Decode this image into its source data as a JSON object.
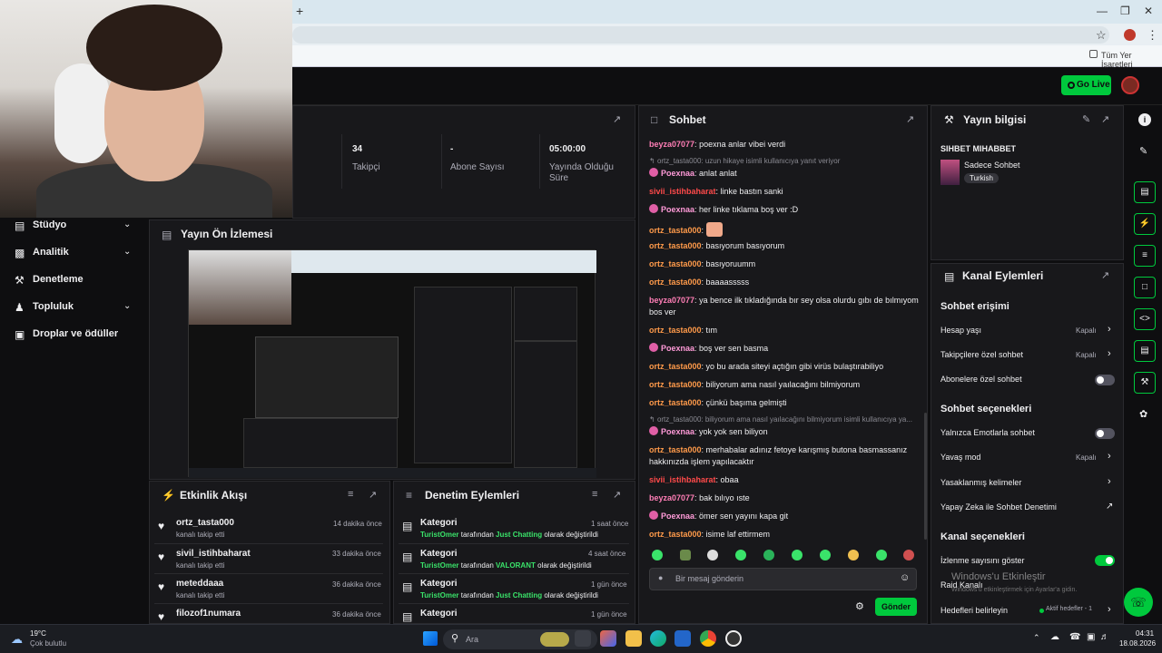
{
  "browser": {
    "new_tab": "+",
    "bookmarks_label": "Tüm Yer İşaretleri"
  },
  "topnav": {
    "go_live": "Go Live"
  },
  "stats": [
    {
      "value": "34",
      "label": "Takipçi"
    },
    {
      "value": "-",
      "label": "Abone Sayısı"
    },
    {
      "value": "05:00:00",
      "label": "Yayında Olduğu Süre"
    }
  ],
  "sidebar": {
    "items": [
      {
        "label": "Stüdyo",
        "icon": "film-icon",
        "chevron": true
      },
      {
        "label": "Analitik",
        "icon": "chart-icon",
        "chevron": true
      },
      {
        "label": "Denetleme",
        "icon": "wrench-icon",
        "chevron": false
      },
      {
        "label": "Topluluk",
        "icon": "community-icon",
        "chevron": true
      },
      {
        "label": "Droplar ve ödüller",
        "icon": "gift-icon",
        "chevron": false
      }
    ]
  },
  "preview": {
    "title": "Yayın Ön İzlemesi"
  },
  "activity": {
    "title": "Etkinlik Akışı",
    "items": [
      {
        "name": "ortz_tasta000",
        "sub": "kanalı takip etti",
        "time": "14 dakika önce"
      },
      {
        "name": "sivil_istihbaharat",
        "sub": "kanalı takip etti",
        "time": "33 dakika önce"
      },
      {
        "name": "meteddaaa",
        "sub": "kanalı takip etti",
        "time": "36 dakika önce"
      },
      {
        "name": "filozof1numara",
        "sub": "",
        "time": "36 dakika önce"
      }
    ]
  },
  "modactions": {
    "title": "Denetim Eylemleri",
    "items": [
      {
        "name": "Kategori",
        "actor": "TuristOmer",
        "mid": " tarafından ",
        "target": "Just Chatting",
        "tail": " olarak değiştirildi",
        "time": "1 saat önce"
      },
      {
        "name": "Kategori",
        "actor": "TuristOmer",
        "mid": " tarafından ",
        "target": "VALORANT",
        "tail": " olarak değiştirildi",
        "time": "4 saat önce"
      },
      {
        "name": "Kategori",
        "actor": "TuristOmer",
        "mid": " tarafından ",
        "target": "Just Chatting",
        "tail": " olarak değiştirildi",
        "time": "1 gün önce"
      },
      {
        "name": "Kategori",
        "actor": "",
        "mid": "",
        "target": "",
        "tail": "",
        "time": "1 gün önce"
      }
    ]
  },
  "chat": {
    "title": "Sohbet",
    "placeholder": "Bir mesaj gönderin",
    "send": "Gönder",
    "messages": [
      {
        "user": "beyza07077",
        "color": "#ff7eb6",
        "text": "poexna anlar vibei verdi"
      },
      {
        "reply": "ortz_tasta000: uzun hikaye isimli kullanıcıya yanıt veriyor"
      },
      {
        "user": "Poexnaa",
        "color": "#ff9ad8",
        "badge": true,
        "text": "anlat anlat"
      },
      {
        "user": "sivii_istihbaharat",
        "color": "#ff4a4a",
        "text": "linke bastın sanki"
      },
      {
        "user": "Poexnaa",
        "color": "#ff9ad8",
        "badge": true,
        "text": "her linke tıklama boş ver :D"
      },
      {
        "user": "ortz_tasta000",
        "color": "#ff9a4a",
        "text": "",
        "emote": true
      },
      {
        "user": "ortz_tasta000",
        "color": "#ff9a4a",
        "text": "basıyorum basıyorum"
      },
      {
        "user": "ortz_tasta000",
        "color": "#ff9a4a",
        "text": "basıyoruumm"
      },
      {
        "user": "ortz_tasta000",
        "color": "#ff9a4a",
        "text": "baaaasssss"
      },
      {
        "user": "beyza07077",
        "color": "#ff7eb6",
        "text": "ya bence ilk tıkladığında bır sey olsa olurdu gıbı de bılmıyom bos ver"
      },
      {
        "user": "ortz_tasta000",
        "color": "#ff9a4a",
        "text": "tım"
      },
      {
        "user": "Poexnaa",
        "color": "#ff9ad8",
        "badge": true,
        "text": "boş ver sen basma"
      },
      {
        "user": "ortz_tasta000",
        "color": "#ff9a4a",
        "text": "yo bu arada siteyi açtığın gibi virüs bulaştırabiliyo"
      },
      {
        "user": "ortz_tasta000",
        "color": "#ff9a4a",
        "text": "biliyorum ama nasıl yaılacağını bilmiyorum"
      },
      {
        "user": "ortz_tasta000",
        "color": "#ff9a4a",
        "text": "çünkü başıma gelmişti"
      },
      {
        "reply": "ortz_tasta000: biliyorum ama nasıl yaılacağını bilmiyorum isimli kullanıcıya ya..."
      },
      {
        "user": "Poexnaa",
        "color": "#ff9ad8",
        "badge": true,
        "text": "yok yok sen biliyon"
      },
      {
        "user": "ortz_tasta000",
        "color": "#ff9a4a",
        "text": "merhabalar adınız fetoye karışmış butona basmassanız hakkınızda işlem yapılacaktır"
      },
      {
        "user": "sivii_istihbaharat",
        "color": "#ff4a4a",
        "text": "obaa"
      },
      {
        "user": "beyza07077",
        "color": "#ff7eb6",
        "text": "bak bılıyo ıste"
      },
      {
        "user": "Poexnaa",
        "color": "#ff9ad8",
        "badge": true,
        "text": "ömer sen yayını kapa git"
      },
      {
        "user": "ortz_tasta000",
        "color": "#ff9a4a",
        "text": "isime laf ettirmem"
      }
    ]
  },
  "info": {
    "title": "Yayın bilgisi",
    "stream_title": "SIHBET MIHABBET",
    "category": "Sadece Sohbet",
    "tag": "Turkish"
  },
  "channel": {
    "title": "Kanal Eylemleri",
    "sections": [
      {
        "heading": "Sohbet erişimi",
        "rows": [
          {
            "label": "Hesap yaşı",
            "value": "Kapalı",
            "control": "chevron"
          },
          {
            "label": "Takipçilere özel sohbet",
            "value": "Kapalı",
            "control": "chevron"
          },
          {
            "label": "Abonelere özel sohbet",
            "value": "",
            "control": "toggle-off"
          }
        ]
      },
      {
        "heading": "Sohbet seçenekleri",
        "rows": [
          {
            "label": "Yalnızca Emotlarla sohbet",
            "value": "",
            "control": "toggle-off"
          },
          {
            "label": "Yavaş mod",
            "value": "Kapalı",
            "control": "chevron"
          },
          {
            "label": "Yasaklanmış kelimeler",
            "value": "",
            "control": "chevron"
          },
          {
            "label": "Yapay Zeka ile Sohbet Denetimi",
            "value": "",
            "control": "external"
          }
        ]
      },
      {
        "heading": "Kanal seçenekleri",
        "rows": [
          {
            "label": "İzlenme sayısını göster",
            "value": "",
            "control": "toggle-on"
          },
          {
            "label": "Raid Kanalı",
            "value": "",
            "control": "none"
          },
          {
            "label": "Hedefleri belirleyin",
            "value": "Aktif hedefler - 1",
            "control": "chevron"
          }
        ]
      }
    ]
  },
  "watermark": {
    "line1": "Windows'u Etkinleştir",
    "line2": "Windows'u etkinleştirmek için Ayarlar'a gidin."
  },
  "taskbar": {
    "weather_temp": "19°C",
    "weather_desc": "Çok bulutlu",
    "search": "Ara",
    "time": "04:31",
    "date": "18.08.2026"
  },
  "colors": {
    "accent": "#00c93d",
    "panel": "#18181b",
    "bg": "#0e0e10"
  }
}
